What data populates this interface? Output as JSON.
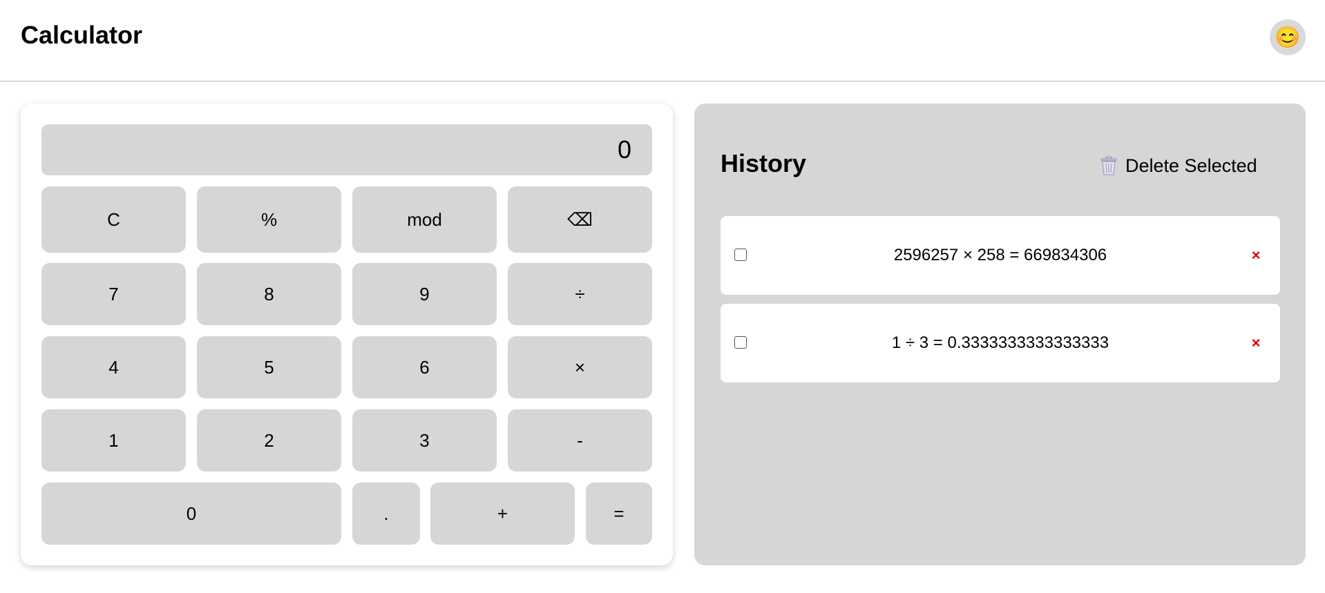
{
  "header": {
    "title": "Calculator",
    "avatar": "😊"
  },
  "calculator": {
    "display": "0",
    "keys": {
      "clear": "C",
      "percent": "%",
      "mod": "mod",
      "backspace": "⌫",
      "seven": "7",
      "eight": "8",
      "nine": "9",
      "divide": "÷",
      "four": "4",
      "five": "5",
      "six": "6",
      "multiply": "×",
      "one": "1",
      "two": "2",
      "three": "3",
      "minus": "-",
      "zero": "0",
      "decimal": ".",
      "plus": "+",
      "equals": "="
    }
  },
  "history": {
    "title": "History",
    "delete_selected_label": "Delete Selected",
    "delete_icon": "trash-icon",
    "entries": [
      {
        "expression": "2596257 × 258 = 669834306",
        "remove": "×"
      },
      {
        "expression": "1 ÷ 3 = 0.3333333333333333",
        "remove": "×"
      }
    ]
  },
  "colors": {
    "key_bg": "#d6d6d6",
    "panel_bg": "#d6d6d6",
    "remove_red": "#e00000"
  }
}
